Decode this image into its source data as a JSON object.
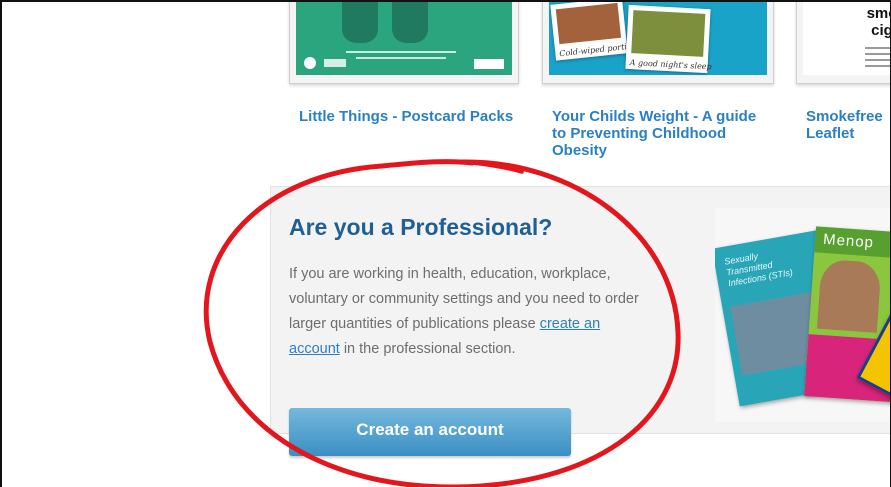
{
  "products": [
    {
      "title": "Little Things - Postcard Packs"
    },
    {
      "title": "Your Childs Weight - A guide to Preventing Childhood Obesity",
      "thumb_captions": [
        "Cold-wiped portions",
        "A good night's sleep"
      ]
    },
    {
      "title": "Smokefree Leaflet",
      "thumb_heading": "smo cig"
    }
  ],
  "professional": {
    "heading": "Are you a Professional?",
    "text_before_link": "If you are working in health, education, workplace, voluntary or community settings and you need to order larger quantities of publications please ",
    "link_label": "create an account",
    "text_after_link": " in the professional section.",
    "button_label": "Create an account",
    "brochures": [
      {
        "title": "Sexually Transmitted Infections (STIs)"
      },
      {
        "title": "Menop"
      }
    ]
  },
  "colors": {
    "link_blue": "#2b80c3",
    "heading_blue": "#1f5f94",
    "body_gray": "#6e6e6e",
    "button_top": "#75b8dd",
    "button_bottom": "#3b8fc3",
    "annotation_red": "#e2161c"
  }
}
